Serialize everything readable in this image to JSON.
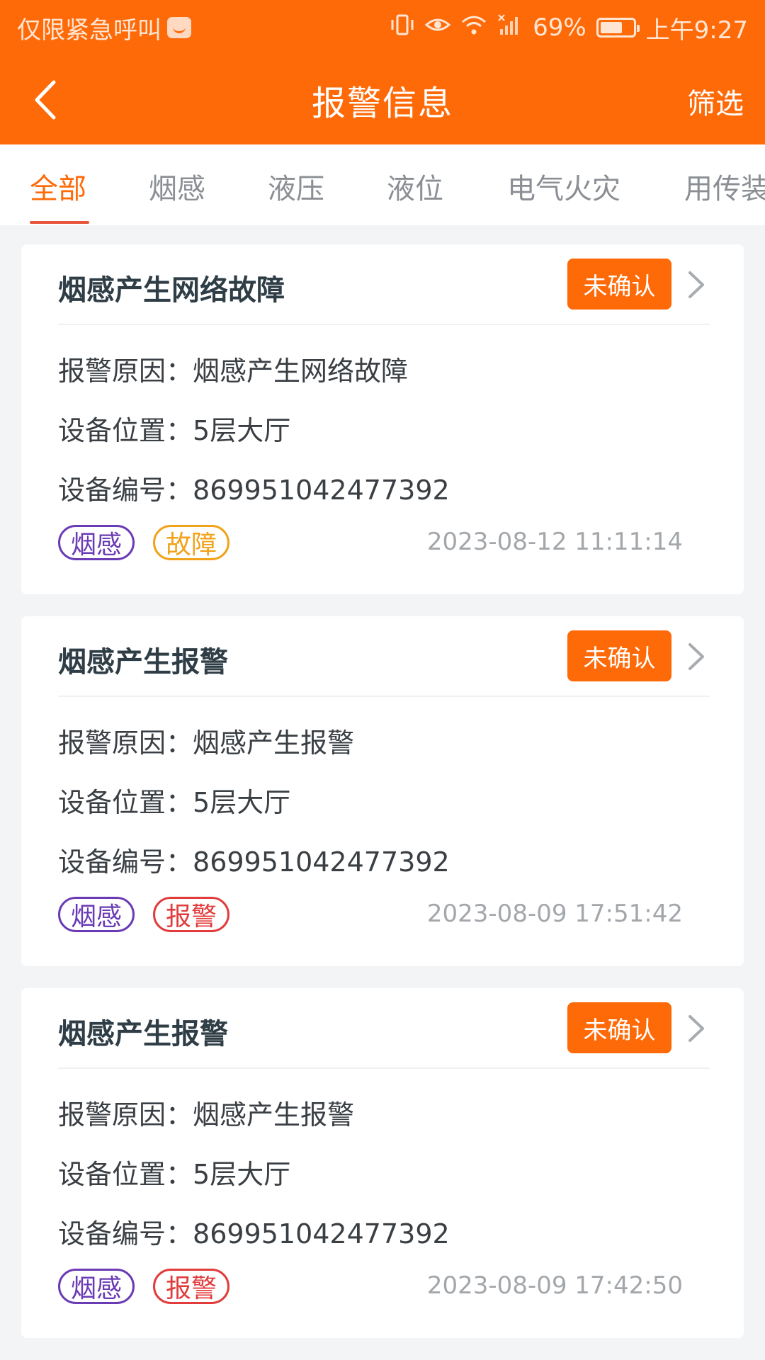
{
  "status_bar": {
    "left_text": "仅限紧急呼叫",
    "battery_percent": "69%",
    "battery_level": 0.69,
    "time": "上午9:27"
  },
  "nav": {
    "title": "报警信息",
    "filter_label": "筛选"
  },
  "tabs": [
    {
      "label": "全部"
    },
    {
      "label": "烟感"
    },
    {
      "label": "液压"
    },
    {
      "label": "液位"
    },
    {
      "label": "电气火灾"
    },
    {
      "label": "用传装置"
    }
  ],
  "field_labels": {
    "reason": "报警原因：",
    "location": "设备位置：",
    "device_no": "设备编号："
  },
  "cards": [
    {
      "title": "烟感产生网络故障",
      "status": "未确认",
      "reason": "烟感产生网络故障",
      "location": "5层大厅",
      "device_no": "869951042477392",
      "tag_type": "烟感",
      "tag_level": "故障",
      "time": "2023-08-12 11:11:14"
    },
    {
      "title": "烟感产生报警",
      "status": "未确认",
      "reason": "烟感产生报警",
      "location": "5层大厅",
      "device_no": "869951042477392",
      "tag_type": "烟感",
      "tag_level": "报警",
      "time": "2023-08-09 17:51:42"
    },
    {
      "title": "烟感产生报警",
      "status": "未确认",
      "reason": "烟感产生报警",
      "location": "5层大厅",
      "device_no": "869951042477392",
      "tag_type": "烟感",
      "tag_level": "报警",
      "time": "2023-08-09 17:42:50"
    }
  ],
  "colors": {
    "brand": "#ff6a08",
    "tag_smoke": "#6a3bb5",
    "tag_fault": "#f0a21a",
    "tag_alarm": "#e13b3b"
  }
}
